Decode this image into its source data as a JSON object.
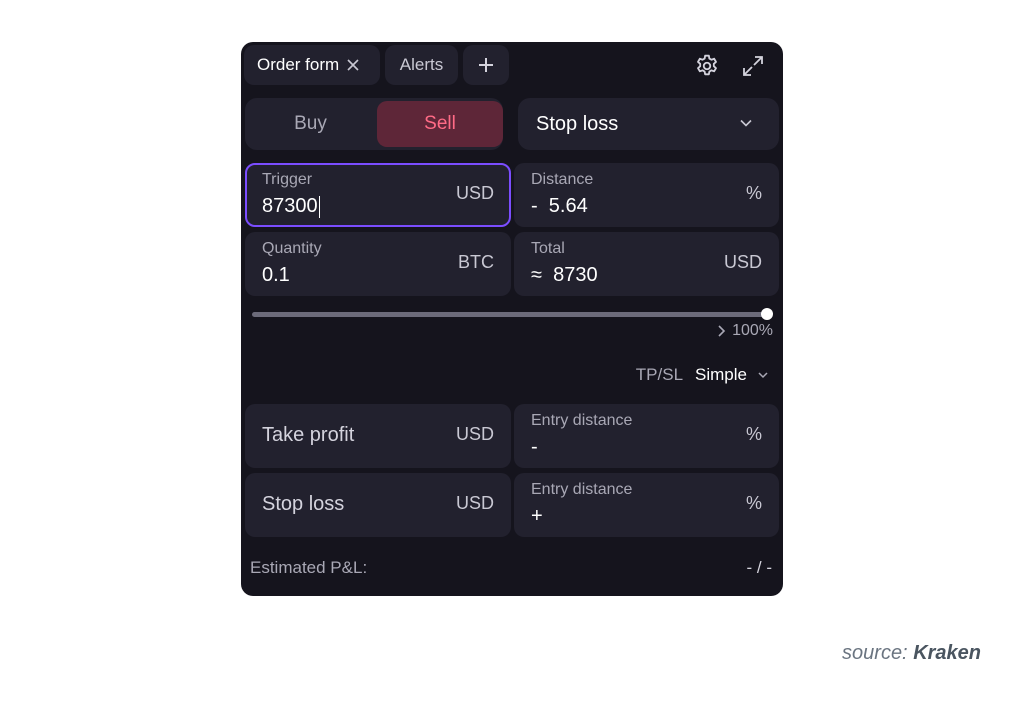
{
  "tabs": [
    {
      "label": "Order form"
    },
    {
      "label": "Alerts"
    }
  ],
  "side": {
    "buy": "Buy",
    "sell": "Sell",
    "selected": "Sell"
  },
  "order_type": {
    "selected": "Stop loss"
  },
  "trigger": {
    "label": "Trigger",
    "value": "87300",
    "unit": "USD"
  },
  "distance": {
    "label": "Distance",
    "value": "-  5.64",
    "unit": "%"
  },
  "quantity": {
    "label": "Quantity",
    "value": "0.1",
    "unit": "BTC"
  },
  "total": {
    "label": "Total",
    "value": "≈  8730",
    "unit": "USD"
  },
  "slider": {
    "level_percent": 100,
    "label": "100%"
  },
  "tpsl": {
    "label": "TP/SL",
    "mode": "Simple"
  },
  "take_profit": {
    "label": "Take profit",
    "unit": "USD",
    "distance_label": "Entry distance",
    "distance_value": "-",
    "distance_unit": "%"
  },
  "stop_loss": {
    "label": "Stop loss",
    "unit": "USD",
    "distance_label": "Entry distance",
    "distance_value": "+",
    "distance_unit": "%"
  },
  "estimated_pl": {
    "label": "Estimated P&L:",
    "value": "- / -"
  },
  "caption": {
    "prefix": "source:",
    "brand": "Kraken"
  },
  "colors": {
    "panel": "#15141d",
    "field": "#22212e",
    "sell_bg": "#5e2638",
    "sell_text": "#ff6b86",
    "focus": "#7b4dff"
  },
  "icons": [
    "close-icon",
    "plus-icon",
    "gear-icon",
    "expand-icon",
    "chevron-down-icon",
    "chevron-right-icon"
  ]
}
